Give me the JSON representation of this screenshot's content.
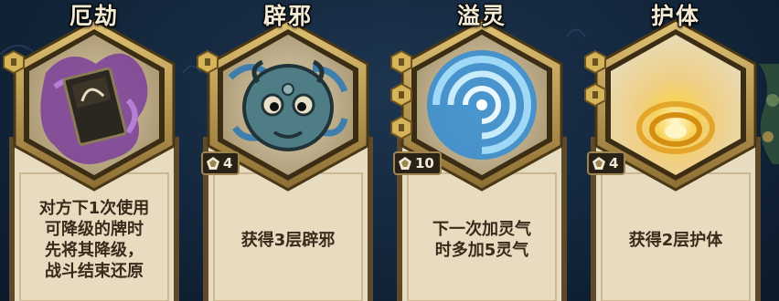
{
  "cards": [
    {
      "title": "厄劫",
      "art_icon": "cursed-card-icon",
      "coins": 1,
      "cost": "",
      "description": "对方下1次使用\n可降级的牌时\n先将其降级，\n战斗结束还原"
    },
    {
      "title": "辟邪",
      "art_icon": "guardian-beast-icon",
      "coins": 1,
      "cost": "4",
      "description": "获得3层辟邪"
    },
    {
      "title": "溢灵",
      "art_icon": "spirit-vortex-icon",
      "coins": 3,
      "cost": "10",
      "description": "下一次加灵气\n时多加5灵气"
    },
    {
      "title": "护体",
      "art_icon": "golden-shield-icon",
      "coins": 2,
      "cost": "4",
      "description": "获得2层护体"
    }
  ],
  "colors": {
    "frame_gold": "#c7a85e",
    "frame_dark": "#5b4621",
    "parchment": "#e8dcc0",
    "text": "#3a2a1c"
  }
}
